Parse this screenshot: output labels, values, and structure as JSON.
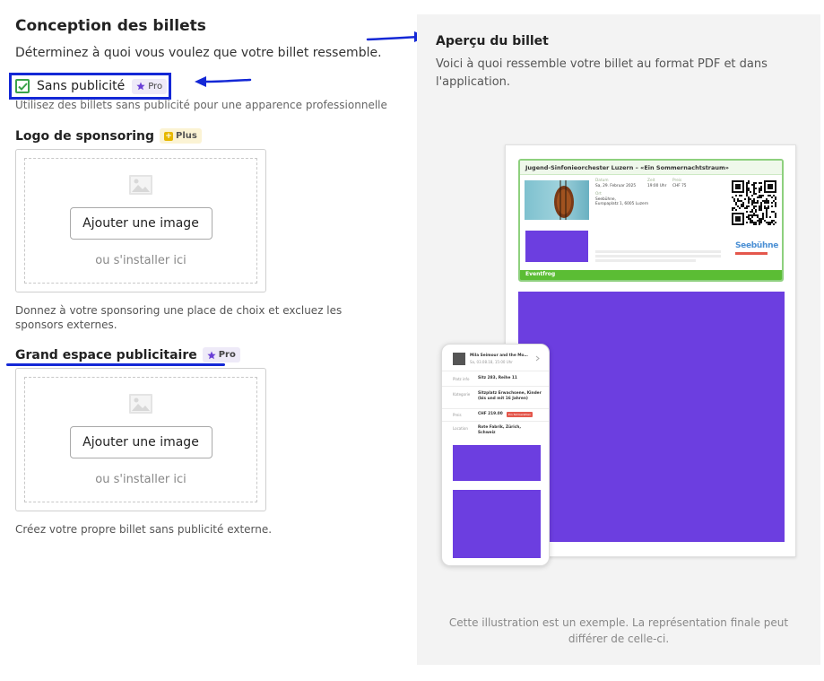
{
  "left": {
    "title": "Conception des billets",
    "subtitle": "Déterminez à quoi vous voulez que votre billet ressemble.",
    "no_ads": {
      "label": "Sans publicité",
      "checked": true,
      "badge": "Pro",
      "hint": "Utilisez des billets sans publicité pour une apparence professionnelle"
    },
    "sponsor_logo": {
      "label": "Logo de sponsoring",
      "badge": "Plus",
      "add_button": "Ajouter une image",
      "or_text": "ou s'installer ici",
      "description": "Donnez à votre sponsoring une place de choix et excluez les sponsors externes."
    },
    "ad_space": {
      "label": "Grand espace publicitaire",
      "badge": "Pro",
      "add_button": "Ajouter une image",
      "or_text": "ou s'installer ici",
      "description": "Créez votre propre billet sans publicité externe."
    }
  },
  "preview": {
    "title": "Aperçu du billet",
    "description": "Voici à quoi ressemble votre billet au format PDF et dans l'application.",
    "ticket": {
      "header": "Jugend-Sinfonieorchester Luzern – «Ein Sommernachtstraum»",
      "date_label": "Datum",
      "date_value": "Sa, 29. Februar 2025",
      "time_label": "Zeit",
      "time_value": "19:00 Uhr",
      "price_label": "Preis",
      "price_value": "CHF 75",
      "venue_label": "Ort",
      "venue_line1": "Seebühne,",
      "venue_line2": "Europaplatz 1, 6005 Luzern",
      "sponsor_name": "Seebühne",
      "footer": "Eventfrog"
    },
    "phone": {
      "event_title": "Mila Seimour and the Mo…",
      "event_date": "Sa, 03.08.18, 15:00 Uhr",
      "place_label": "Platz info",
      "place_value": "Sitz 283, Reihe 11",
      "category_label": "Kategorie",
      "category_value_1": "Sitzplatz Erwachsene, Kinder",
      "category_value_2": "(bis und mit 16 Jahren)",
      "price_label": "Preis",
      "price_value": "CHF 219.00",
      "price_badge": "Ein Tell bezahlen",
      "location_label": "Location",
      "location_value_1": "Rote Fabrik, Zürich,",
      "location_value_2": "Schweiz"
    },
    "footer_note": "Cette illustration est un exemple. La représentation finale peut différer de celle-ci."
  },
  "colors": {
    "annotation_blue": "#1428d6",
    "check_green": "#3aa34a",
    "ad_purple": "#6c3ee0",
    "pro_star": "#6a3fd6",
    "plus_yellow": "#e7b800",
    "ticket_green": "#5bbd34"
  },
  "icons": [
    "check-icon",
    "star-icon",
    "plus-square-icon",
    "image-placeholder-icon",
    "arrow-annotation-icon",
    "qr-code-icon",
    "chevron-right-icon"
  ]
}
